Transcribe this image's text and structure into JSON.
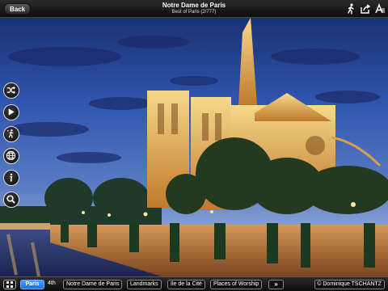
{
  "header": {
    "back_label": "Back",
    "title": "Notre Dame de Paris",
    "subtitle": "Best of Paris (2/777)"
  },
  "top_icons": [
    "walking-person-icon",
    "share-icon",
    "text-size-icon"
  ],
  "side_buttons": [
    "shuffle-icon",
    "play-icon",
    "tour-icon",
    "globe-icon",
    "info-icon",
    "search-icon"
  ],
  "breadcrumbs": {
    "items": [
      {
        "label": "Paris",
        "active": true
      },
      {
        "label": "4th",
        "active": false
      },
      {
        "label": "Notre Dame de Paris",
        "active": false
      },
      {
        "label": "Landmarks",
        "active": false
      },
      {
        "label": "Ile de la Cité",
        "active": false
      },
      {
        "label": "Places of Worship",
        "active": false
      }
    ],
    "more_label": "»"
  },
  "credit": {
    "copyright_symbol": "©",
    "label": "Dominique TSCHANTZ"
  },
  "colors": {
    "sky_top": "#1a2f6e",
    "sky_mid": "#3f63b8",
    "sky_horizon": "#8aa3cf",
    "cathedral_light": "#f0c060",
    "active_tab": "#2a86ee"
  }
}
